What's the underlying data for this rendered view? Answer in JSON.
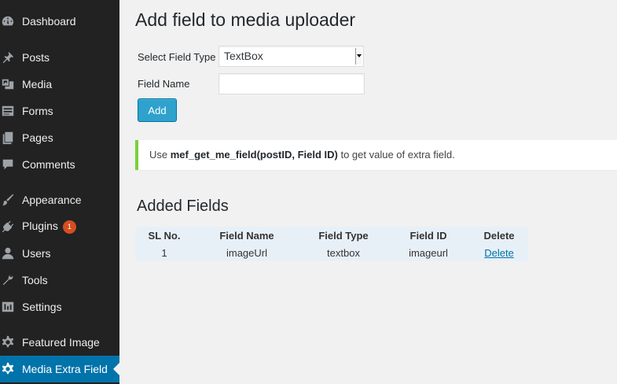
{
  "sidebar": {
    "items": [
      {
        "label": "Dashboard",
        "icon": "dashboard-icon"
      },
      {
        "label": "Posts",
        "icon": "pin-icon"
      },
      {
        "label": "Media",
        "icon": "media-icon"
      },
      {
        "label": "Forms",
        "icon": "forms-icon"
      },
      {
        "label": "Pages",
        "icon": "pages-icon"
      },
      {
        "label": "Comments",
        "icon": "comments-icon"
      },
      {
        "label": "Appearance",
        "icon": "brush-icon"
      },
      {
        "label": "Plugins",
        "icon": "plugin-icon",
        "badge": "1"
      },
      {
        "label": "Users",
        "icon": "users-icon"
      },
      {
        "label": "Tools",
        "icon": "wrench-icon"
      },
      {
        "label": "Settings",
        "icon": "settings-icon"
      },
      {
        "label": "Featured Image",
        "icon": "gear-icon"
      },
      {
        "label": "Media Extra Field",
        "icon": "gear-icon",
        "active": true
      }
    ]
  },
  "form": {
    "title": "Add field to media uploader",
    "select_label": "Select Field Type",
    "select_value": "TextBox",
    "name_label": "Field Name",
    "name_value": "",
    "add_label": "Add"
  },
  "notice": {
    "prefix": "Use",
    "code": "mef_get_me_field(postID, Field ID)",
    "suffix": "to get value of extra field."
  },
  "added": {
    "title": "Added Fields",
    "headers": [
      "SL No.",
      "Field Name",
      "Field Type",
      "Field ID",
      "Delete"
    ],
    "rows": [
      {
        "sl": "1",
        "name": "imageUrl",
        "type": "textbox",
        "id": "imageurl",
        "delete": "Delete"
      }
    ]
  },
  "colors": {
    "sidebar_bg": "#222222",
    "active_bg": "#0073aa",
    "button_bg": "#2ea2cc",
    "notice_border": "#7ad03a",
    "badge_bg": "#d54e21"
  }
}
